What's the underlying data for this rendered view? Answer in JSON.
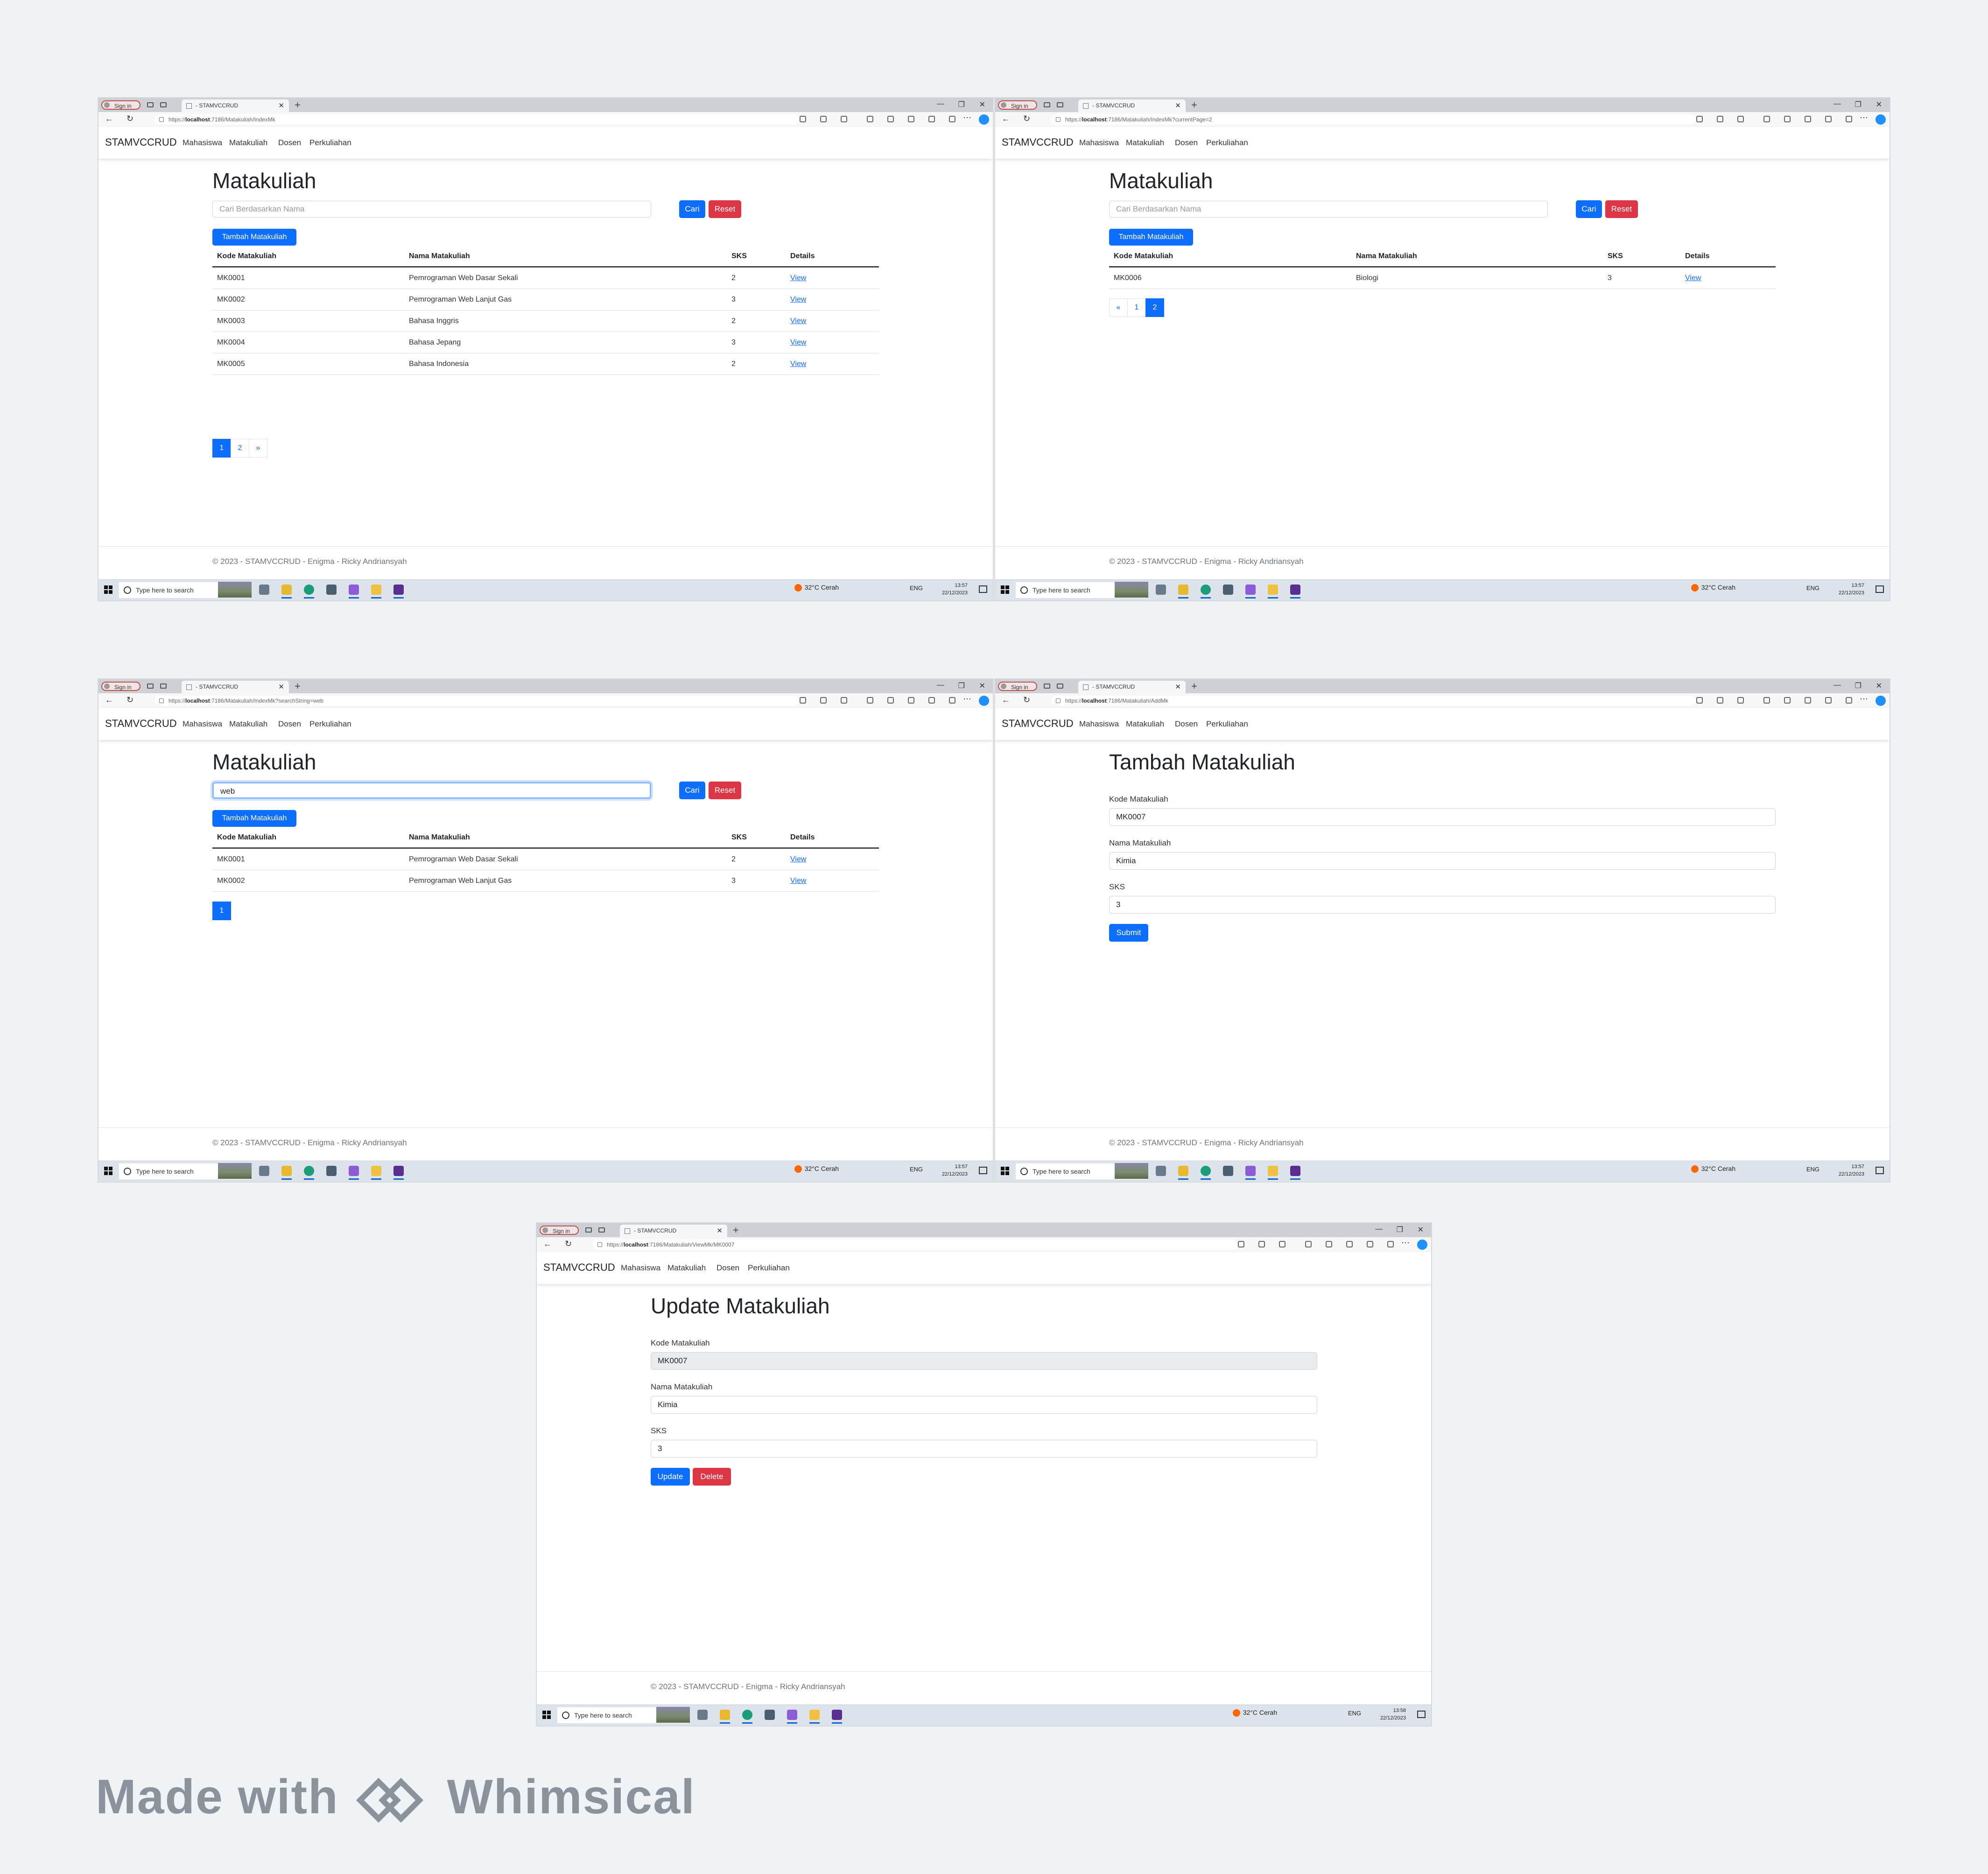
{
  "browser": {
    "sign_in": "Sign in",
    "tab_title": "- STAMVCCRUD",
    "url_prefix": "https://",
    "url_host": "localhost",
    "search_box": "Type here to search",
    "weather": "32°C Cerah",
    "lang": "ENG",
    "date": "22/12/2023"
  },
  "app": {
    "brand": "STAMVCCRUD",
    "nav": [
      "Mahasiswa",
      "Matakuliah",
      "Dosen",
      "Perkuliahan"
    ],
    "footer": "© 2023 - STAMVCCRUD - Enigma - Ricky Andriansyah"
  },
  "list_common": {
    "title": "Matakuliah",
    "search_placeholder": "Cari Berdasarkan Nama",
    "cari": "Cari",
    "reset": "Reset",
    "tambah": "Tambah Matakuliah",
    "headers": [
      "Kode Matakuliah",
      "Nama Matakuliah",
      "SKS",
      "Details"
    ],
    "view": "View"
  },
  "screen1": {
    "url_path": ":7186/Matakuliah/IndexMk",
    "time": "13:57",
    "rows": [
      [
        "MK0001",
        "Pemrograman Web Dasar Sekali",
        "2",
        "View"
      ],
      [
        "MK0002",
        "Pemrograman Web Lanjut Gas",
        "3",
        "View"
      ],
      [
        "MK0003",
        "Bahasa Inggris",
        "2",
        "View"
      ],
      [
        "MK0004",
        "Bahasa Jepang",
        "3",
        "View"
      ],
      [
        "MK0005",
        "Bahasa Indonesia",
        "2",
        "View"
      ]
    ],
    "pages": [
      "1",
      "2",
      "»"
    ]
  },
  "screen2": {
    "url_path": ":7186/Matakuliah/IndexMk?currentPage=2",
    "time": "13:57",
    "rows": [
      [
        "MK0006",
        "Biologi",
        "3",
        "View"
      ]
    ],
    "pages": [
      "«",
      "1",
      "2"
    ]
  },
  "screen3": {
    "url_path": ":7186/Matakuliah/IndexMk?searchString=web",
    "time": "13:57",
    "search_value": "web",
    "rows": [
      [
        "MK0001",
        "Pemrograman Web Dasar Sekali",
        "2",
        "View"
      ],
      [
        "MK0002",
        "Pemrograman Web Lanjut Gas",
        "3",
        "View"
      ]
    ],
    "pages": [
      "1"
    ]
  },
  "screen4": {
    "url_path": ":7186/Matakuliah/AddMk",
    "time": "13:57",
    "title": "Tambah Matakuliah",
    "kode_label": "Kode Matakuliah",
    "kode_value": "MK0007",
    "nama_label": "Nama Matakuliah",
    "nama_value": "Kimia",
    "sks_label": "SKS",
    "sks_value": "3",
    "submit": "Submit"
  },
  "screen5": {
    "url_path": ":7186/Matakuliah/ViewMk/MK0007",
    "time": "13:58",
    "title": "Update Matakuliah",
    "kode_label": "Kode Matakuliah",
    "kode_value": "MK0007",
    "nama_label": "Nama Matakuliah",
    "nama_value": "Kimia",
    "sks_label": "SKS",
    "sks_value": "3",
    "update": "Update",
    "delete": "Delete"
  },
  "watermark": {
    "made_with": "Made with",
    "brand": "Whimsical"
  }
}
